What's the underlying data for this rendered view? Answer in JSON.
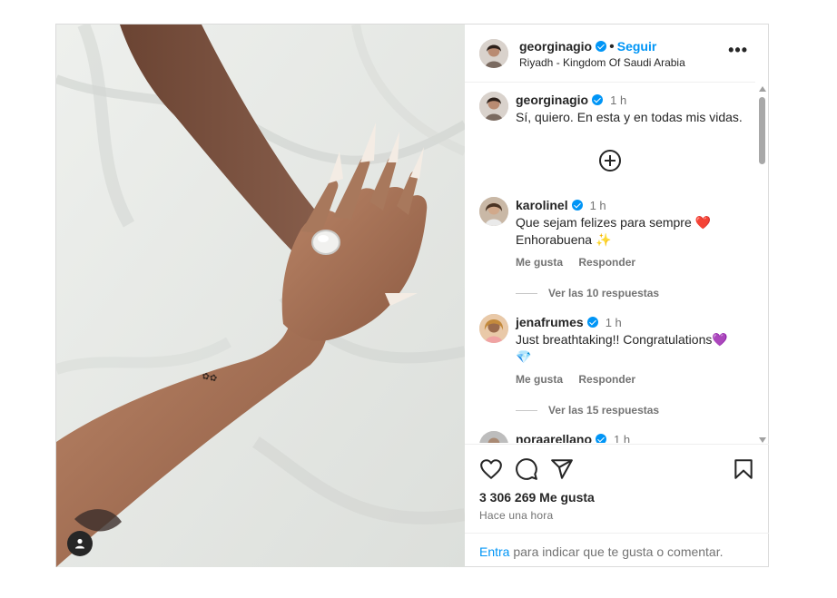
{
  "post": {
    "author": {
      "username": "georginagio",
      "verified": true,
      "follow_label": "Seguir",
      "location": "Riyadh - Kingdom Of Saudi Arabia"
    },
    "more_label": "•••"
  },
  "comments": [
    {
      "username": "georginagio",
      "verified": true,
      "time": "1 h",
      "text": "Sí, quiero. En esta y en todas mis vidas."
    },
    {
      "username": "karolinel",
      "verified": true,
      "time": "1 h",
      "text_line1": "Que sejam felizes para sempre ❤️",
      "text_line2": "Enhorabuena ✨",
      "like_label": "Me gusta",
      "reply_label": "Responder",
      "replies_label": "Ver las 10 respuestas"
    },
    {
      "username": "jenafrumes",
      "verified": true,
      "time": "1 h",
      "text_line1": "Just breathtaking!! Congratulations💜",
      "text_line2": "💎",
      "like_label": "Me gusta",
      "reply_label": "Responder",
      "replies_label": "Ver las 15 respuestas"
    },
    {
      "username": "noraarellano",
      "verified": true,
      "time": "1 h"
    }
  ],
  "footer": {
    "likes": "3 306 269 Me gusta",
    "posted_ago": "Hace una hora",
    "login_link": "Entra",
    "login_text": " para indicar que te gusta o comentar."
  },
  "icons": {
    "more_comments": "plus-circle-icon",
    "like": "heart-icon",
    "comment": "comment-icon",
    "share": "share-icon",
    "save": "bookmark-icon",
    "tag": "user-icon",
    "verified": "verified-badge-icon"
  },
  "colors": {
    "accent": "#0095f6",
    "text": "#262626",
    "secondary": "#737373",
    "border": "#dbdbdb"
  }
}
